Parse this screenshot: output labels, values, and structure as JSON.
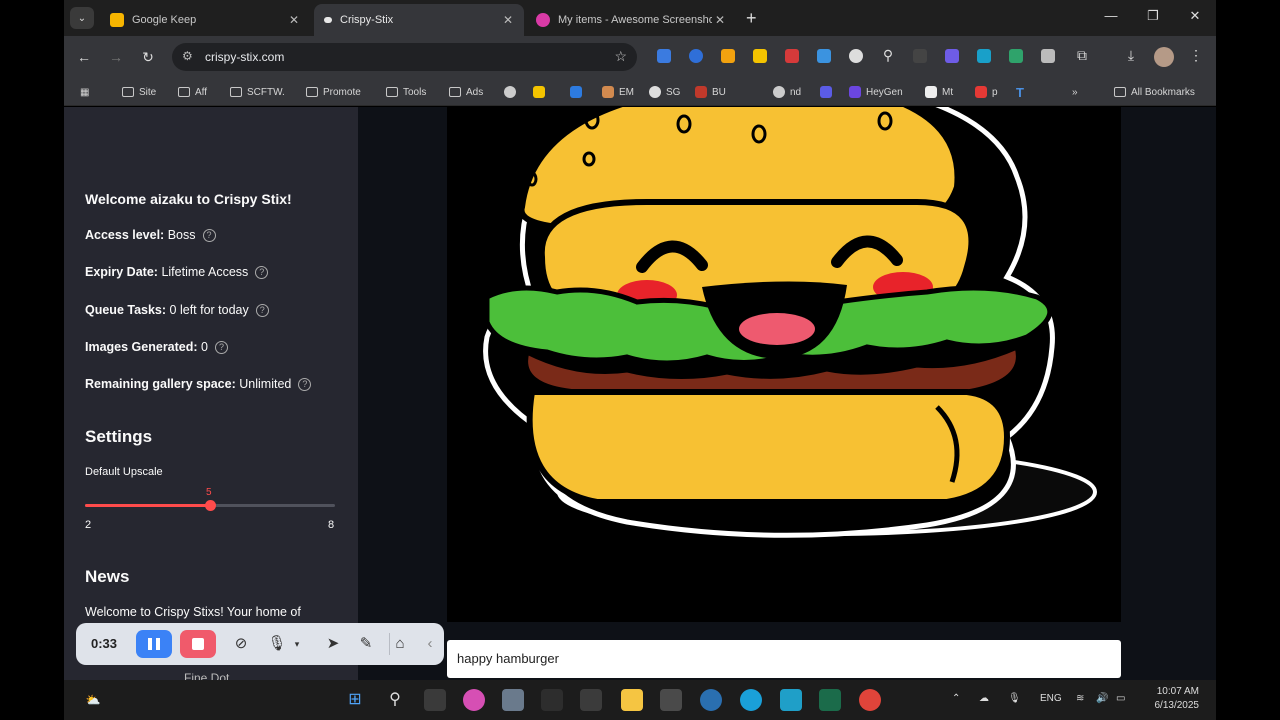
{
  "browser": {
    "tabs": [
      {
        "label": "Google Keep",
        "active": false
      },
      {
        "label": "Crispy-Stix",
        "active": true
      },
      {
        "label": "My items - Awesome Screenshot",
        "active": false
      }
    ],
    "url": "crispy-stix.com"
  },
  "bookmarks": [
    "Site",
    "Aff",
    "SCFTW.",
    "Promote",
    "Tools",
    "Ads",
    "EM",
    "SG",
    "BU",
    "nd",
    "HeyGen",
    "Mt",
    "p",
    "All Bookmarks"
  ],
  "sidebar": {
    "welcome": "Welcome aizaku to Crispy Stix!",
    "access_label": "Access level:",
    "access_value": "Boss",
    "expiry_label": "Expiry Date:",
    "expiry_value": "Lifetime Access",
    "queue_label": "Queue Tasks:",
    "queue_value": "0 left for today",
    "images_label": "Images Generated:",
    "images_value": "0",
    "gallery_label": "Remaining gallery space:",
    "gallery_value": "Unlimited",
    "settings_heading": "Settings",
    "upscale_label": "Default Upscale",
    "upscale_min": "2",
    "upscale_max": "8",
    "upscale_value": "5",
    "news_heading": "News",
    "news_text": "Welcome to Crispy Stixs! Your home of",
    "news_text2": "Fine Dot..."
  },
  "main": {
    "prompt": "happy hamburger"
  },
  "recorder": {
    "time": "0:33"
  },
  "taskbar": {
    "lang": "ENG",
    "time": "10:07 AM",
    "date": "6/13/2025"
  },
  "colors": {
    "accent": "#ff4b4b",
    "sidebar_bg": "#262730",
    "page_bg": "#0e1117"
  }
}
